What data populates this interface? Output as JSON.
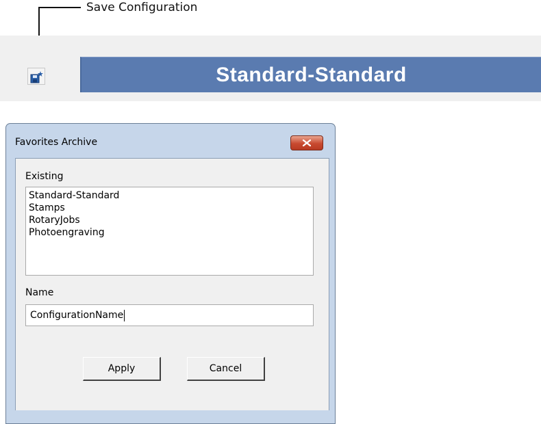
{
  "callout": {
    "label": "Save Configuration"
  },
  "toolbar": {
    "save_config_icon": "save-star-icon",
    "current_config": "Standard-Standard"
  },
  "dialog": {
    "title": "Favorites Archive",
    "close_icon": "close-icon",
    "existing_label": "Existing",
    "existing_items": [
      "Standard-Standard",
      "Stamps",
      "RotaryJobs",
      "Photoengraving"
    ],
    "name_label": "Name",
    "name_value": "ConfigurationName",
    "apply_label": "Apply",
    "cancel_label": "Cancel"
  },
  "colors": {
    "banner": "#5a7bb0",
    "dialog_frame": "#c6d6ea",
    "close_button": "#c84a30"
  }
}
